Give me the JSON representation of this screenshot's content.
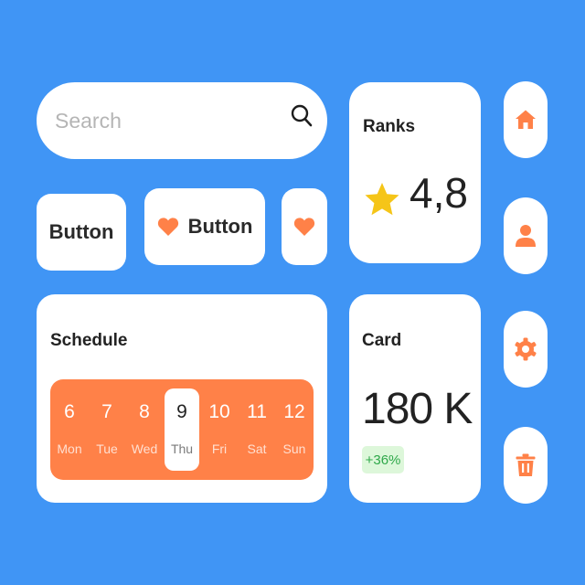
{
  "search": {
    "placeholder": "Search",
    "icon": "search-icon"
  },
  "buttons": {
    "plain_label": "Button",
    "heart_label": "Button",
    "heart_icon": "heart-icon",
    "icon_only": "heart-icon"
  },
  "ranks": {
    "title": "Ranks",
    "value": "4,8",
    "icon": "star-icon"
  },
  "schedule": {
    "title": "Schedule",
    "days": [
      {
        "num": "6",
        "name": "Mon"
      },
      {
        "num": "7",
        "name": "Tue"
      },
      {
        "num": "8",
        "name": "Wed"
      },
      {
        "num": "9",
        "name": "Thu"
      },
      {
        "num": "10",
        "name": "Fri"
      },
      {
        "num": "11",
        "name": "Sat"
      },
      {
        "num": "12",
        "name": "Sun"
      }
    ],
    "selected_index": 3
  },
  "card": {
    "title": "Card",
    "value": "180 K",
    "change": "+36%"
  },
  "side_icons": [
    "home-icon",
    "user-icon",
    "gear-icon",
    "trash-icon"
  ],
  "colors": {
    "background": "#4095F5",
    "accent": "#FF8148",
    "star": "#F5C518",
    "positive_bg": "#DDF7DA",
    "positive_text": "#2fa84a"
  }
}
